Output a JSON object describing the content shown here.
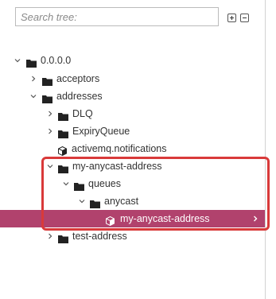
{
  "search": {
    "placeholder": "Search tree:",
    "value": ""
  },
  "colors": {
    "selected_bg": "#b1426d",
    "highlight_border": "#d93a3a"
  },
  "tree": [
    {
      "label": "0.0.0.0",
      "icon": "folder-icon",
      "state": "expanded"
    },
    {
      "label": "acceptors",
      "icon": "folder-icon",
      "state": "collapsed"
    },
    {
      "label": "addresses",
      "icon": "folder-icon",
      "state": "expanded"
    },
    {
      "label": "DLQ",
      "icon": "folder-icon",
      "state": "collapsed"
    },
    {
      "label": "ExpiryQueue",
      "icon": "folder-icon",
      "state": "collapsed"
    },
    {
      "label": "activemq.notifications",
      "icon": "cube-icon",
      "state": "leaf"
    },
    {
      "label": "my-anycast-address",
      "icon": "folder-icon",
      "state": "expanded"
    },
    {
      "label": "queues",
      "icon": "folder-icon",
      "state": "expanded"
    },
    {
      "label": "anycast",
      "icon": "folder-icon",
      "state": "expanded"
    },
    {
      "label": "my-anycast-address",
      "icon": "cube-icon",
      "state": "selected"
    },
    {
      "label": "test-address",
      "icon": "folder-icon",
      "state": "collapsed"
    }
  ]
}
